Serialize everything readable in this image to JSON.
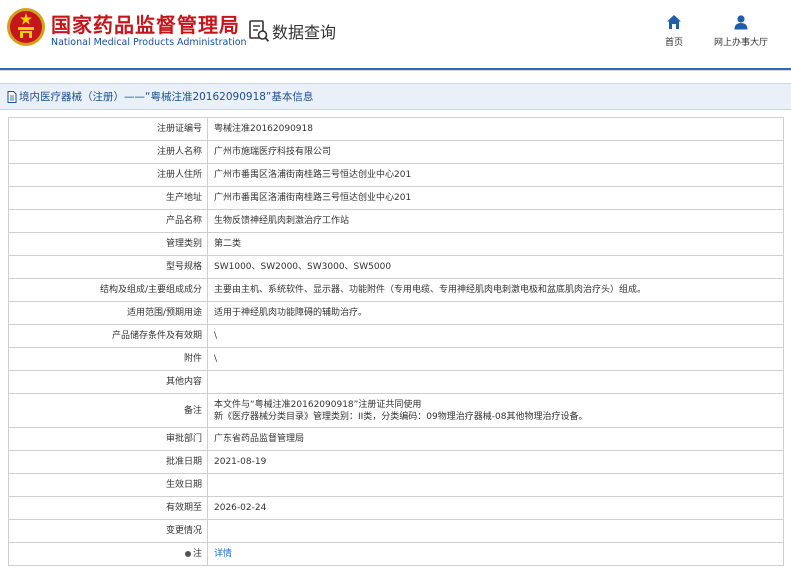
{
  "header": {
    "org_name_cn": "国家药品监督管理局",
    "org_name_en": "National Medical Products Administration",
    "page_label": "数据查询",
    "nav": [
      {
        "label": "首页",
        "icon": "home-icon"
      },
      {
        "label": "网上办事大厅",
        "icon": "user-icon"
      }
    ]
  },
  "breadcrumb": {
    "text": "境内医疗器械（注册）——“粤械注准20162090918”基本信息",
    "icon": "document-icon"
  },
  "rows": [
    {
      "label": "注册证编号",
      "value": "粤械注准20162090918"
    },
    {
      "label": "注册人名称",
      "value": "广州市施瑞医疗科技有限公司"
    },
    {
      "label": "注册人住所",
      "value": "广州市番禺区洛浦街南桂路三号恒达创业中心201"
    },
    {
      "label": "生产地址",
      "value": "广州市番禺区洛浦街南桂路三号恒达创业中心201"
    },
    {
      "label": "产品名称",
      "value": "生物反馈神经肌肉刺激治疗工作站"
    },
    {
      "label": "管理类别",
      "value": "第二类"
    },
    {
      "label": "型号规格",
      "value": "SW1000、SW2000、SW3000、SW5000"
    },
    {
      "label": "结构及组成/主要组成成分",
      "value": "主要由主机、系统软件、显示器、功能附件（专用电缆、专用神经肌肉电刺激电极和盆底肌肉治疗头）组成。"
    },
    {
      "label": "适用范围/预期用途",
      "value": "适用于神经肌肉功能障碍的辅助治疗。"
    },
    {
      "label": "产品储存条件及有效期",
      "value": "\\"
    },
    {
      "label": "附件",
      "value": "\\"
    },
    {
      "label": "其他内容",
      "value": ""
    },
    {
      "label": "备注",
      "value": "本文件与“粤械注准20162090918”注册证共同使用\n新《医疗器械分类目录》管理类别：II类，分类编码：09物理治疗器械-08其他物理治疗设备。"
    },
    {
      "label": "审批部门",
      "value": "广东省药品监督管理局"
    },
    {
      "label": "批准日期",
      "value": "2021-08-19"
    },
    {
      "label": "生效日期",
      "value": ""
    },
    {
      "label": "有效期至",
      "value": "2026-02-24"
    },
    {
      "label": "变更情况",
      "value": ""
    },
    {
      "label": "注",
      "value": "详情",
      "link": true
    }
  ],
  "colors": {
    "brand_red": "#c4161c",
    "brand_blue": "#1a4e9e",
    "link_blue": "#1a6fc7"
  }
}
